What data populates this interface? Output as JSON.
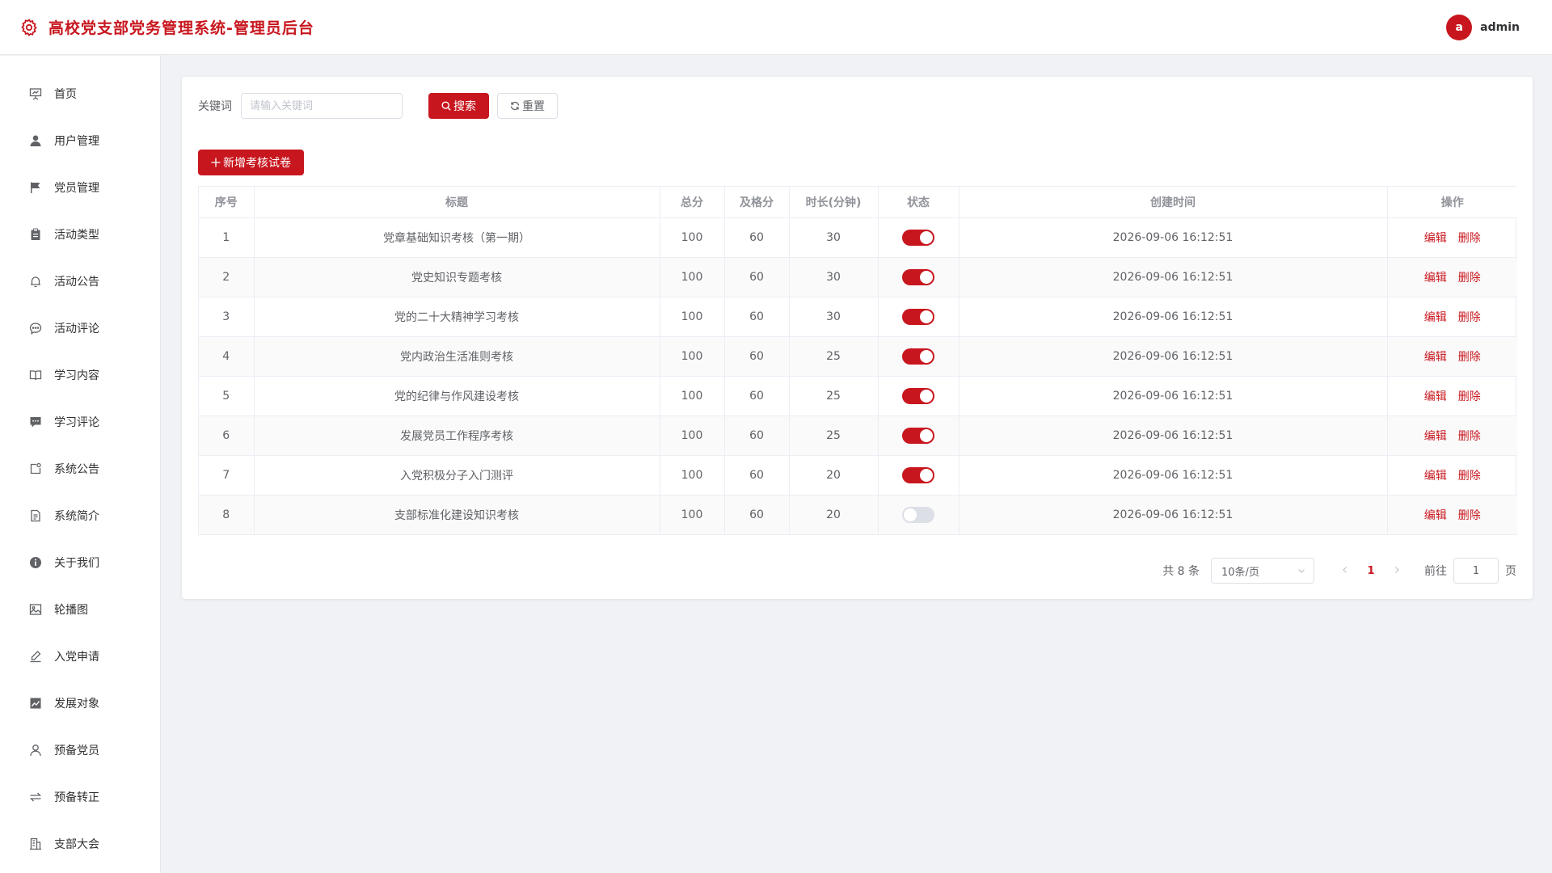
{
  "header": {
    "title": "高校党支部党务管理系统-管理员后台",
    "avatar_letter": "a",
    "username": "admin"
  },
  "colors": {
    "primary": "#c8161e"
  },
  "sidebar": {
    "items": [
      {
        "label": "首页",
        "icon": "presentation-icon"
      },
      {
        "label": "用户管理",
        "icon": "user-icon"
      },
      {
        "label": "党员管理",
        "icon": "flag-icon"
      },
      {
        "label": "活动类型",
        "icon": "clipboard-icon"
      },
      {
        "label": "活动公告",
        "icon": "bell-icon"
      },
      {
        "label": "活动评论",
        "icon": "chat-bubble-icon"
      },
      {
        "label": "学习内容",
        "icon": "book-icon"
      },
      {
        "label": "学习评论",
        "icon": "comment-filled-icon"
      },
      {
        "label": "系统公告",
        "icon": "notice-icon"
      },
      {
        "label": "系统简介",
        "icon": "document-icon"
      },
      {
        "label": "关于我们",
        "icon": "info-icon"
      },
      {
        "label": "轮播图",
        "icon": "picture-icon"
      },
      {
        "label": "入党申请",
        "icon": "edit-pen-icon"
      },
      {
        "label": "发展对象",
        "icon": "trend-chart-icon"
      },
      {
        "label": "预备党员",
        "icon": "user-outline-icon"
      },
      {
        "label": "预备转正",
        "icon": "switch-arrows-icon"
      },
      {
        "label": "支部大会",
        "icon": "office-building-icon"
      }
    ]
  },
  "search": {
    "label": "关键词",
    "placeholder": "请输入关键词",
    "value": "",
    "search_button": "搜索",
    "reset_button": "重置"
  },
  "toolbar": {
    "add_button": "新增考核试卷"
  },
  "table": {
    "columns": [
      "序号",
      "标题",
      "总分",
      "及格分",
      "时长(分钟)",
      "状态",
      "创建时间",
      "操作"
    ],
    "rows": [
      {
        "index": "1",
        "title": "党章基础知识考核（第一期）",
        "total": "100",
        "pass": "60",
        "duration": "30",
        "enabled": true,
        "created": "2026-09-06 16:12:51"
      },
      {
        "index": "2",
        "title": "党史知识专题考核",
        "total": "100",
        "pass": "60",
        "duration": "30",
        "enabled": true,
        "created": "2026-09-06 16:12:51"
      },
      {
        "index": "3",
        "title": "党的二十大精神学习考核",
        "total": "100",
        "pass": "60",
        "duration": "30",
        "enabled": true,
        "created": "2026-09-06 16:12:51"
      },
      {
        "index": "4",
        "title": "党内政治生活准则考核",
        "total": "100",
        "pass": "60",
        "duration": "25",
        "enabled": true,
        "created": "2026-09-06 16:12:51"
      },
      {
        "index": "5",
        "title": "党的纪律与作风建设考核",
        "total": "100",
        "pass": "60",
        "duration": "25",
        "enabled": true,
        "created": "2026-09-06 16:12:51"
      },
      {
        "index": "6",
        "title": "发展党员工作程序考核",
        "total": "100",
        "pass": "60",
        "duration": "25",
        "enabled": true,
        "created": "2026-09-06 16:12:51"
      },
      {
        "index": "7",
        "title": "入党积极分子入门测评",
        "total": "100",
        "pass": "60",
        "duration": "20",
        "enabled": true,
        "created": "2026-09-06 16:12:51"
      },
      {
        "index": "8",
        "title": "支部标准化建设知识考核",
        "total": "100",
        "pass": "60",
        "duration": "20",
        "enabled": false,
        "created": "2026-09-06 16:12:51"
      }
    ],
    "edit_label": "编辑",
    "delete_label": "删除"
  },
  "pagination": {
    "total_text": "共 8 条",
    "page_size": "10条/页",
    "current_page": "1",
    "goto_label": "前往",
    "goto_value": "1",
    "page_unit": "页"
  }
}
